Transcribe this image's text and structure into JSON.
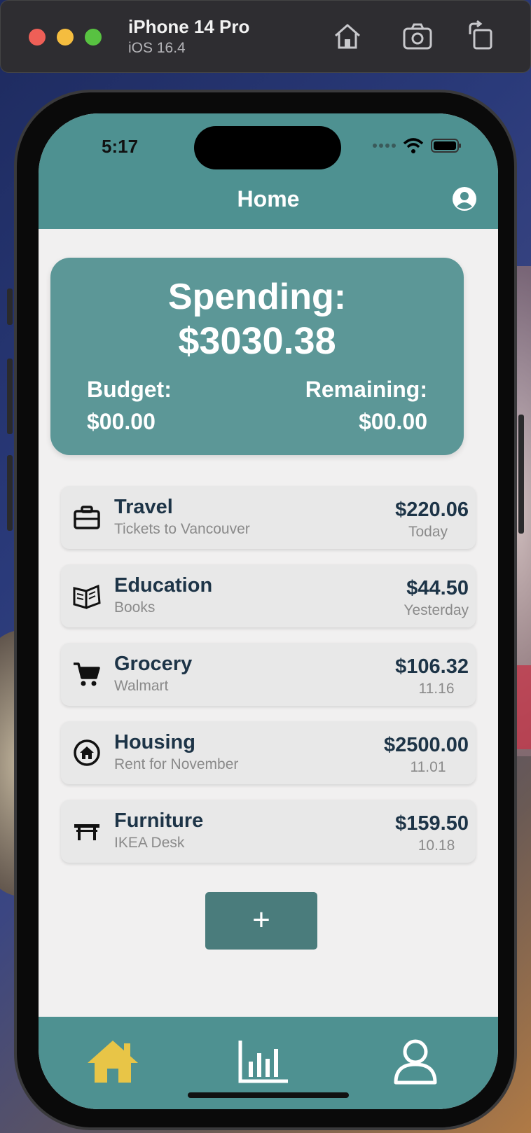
{
  "simulator": {
    "device_name": "iPhone 14 Pro",
    "os_version": "iOS 16.4",
    "toolbar_icons": [
      "home-icon",
      "screenshot-icon",
      "rotate-icon"
    ]
  },
  "status_bar": {
    "time": "5:17"
  },
  "nav": {
    "title": "Home"
  },
  "summary": {
    "spending_label": "Spending:",
    "spending_value": "$3030.38",
    "budget_label": "Budget:",
    "budget_value": "$00.00",
    "remaining_label": "Remaining:",
    "remaining_value": "$00.00"
  },
  "transactions": [
    {
      "category": "Travel",
      "description": "Tickets to Vancouver",
      "amount": "$220.06",
      "date": "Today",
      "icon": "briefcase-icon"
    },
    {
      "category": "Education",
      "description": "Books",
      "amount": "$44.50",
      "date": "Yesterday",
      "icon": "book-icon"
    },
    {
      "category": "Grocery",
      "description": "Walmart",
      "amount": "$106.32",
      "date": "11.16",
      "icon": "cart-icon"
    },
    {
      "category": "Housing",
      "description": "Rent for November",
      "amount": "$2500.00",
      "date": "11.01",
      "icon": "house-circle-icon"
    },
    {
      "category": "Furniture",
      "description": "IKEA Desk",
      "amount": "$159.50",
      "date": "10.18",
      "icon": "table-icon"
    }
  ],
  "add_button": {
    "label": "+"
  },
  "tabbar": {
    "tabs": [
      "home-icon",
      "bar-chart-icon",
      "person-icon"
    ],
    "active_tab": "home-icon"
  },
  "colors": {
    "teal_primary": "#4e9191",
    "card_teal": "#5c9797",
    "add_button": "#4a7c7c",
    "tab_active": "#e8c547",
    "text_dark": "#1d3447",
    "text_muted": "#8a8a8a"
  }
}
